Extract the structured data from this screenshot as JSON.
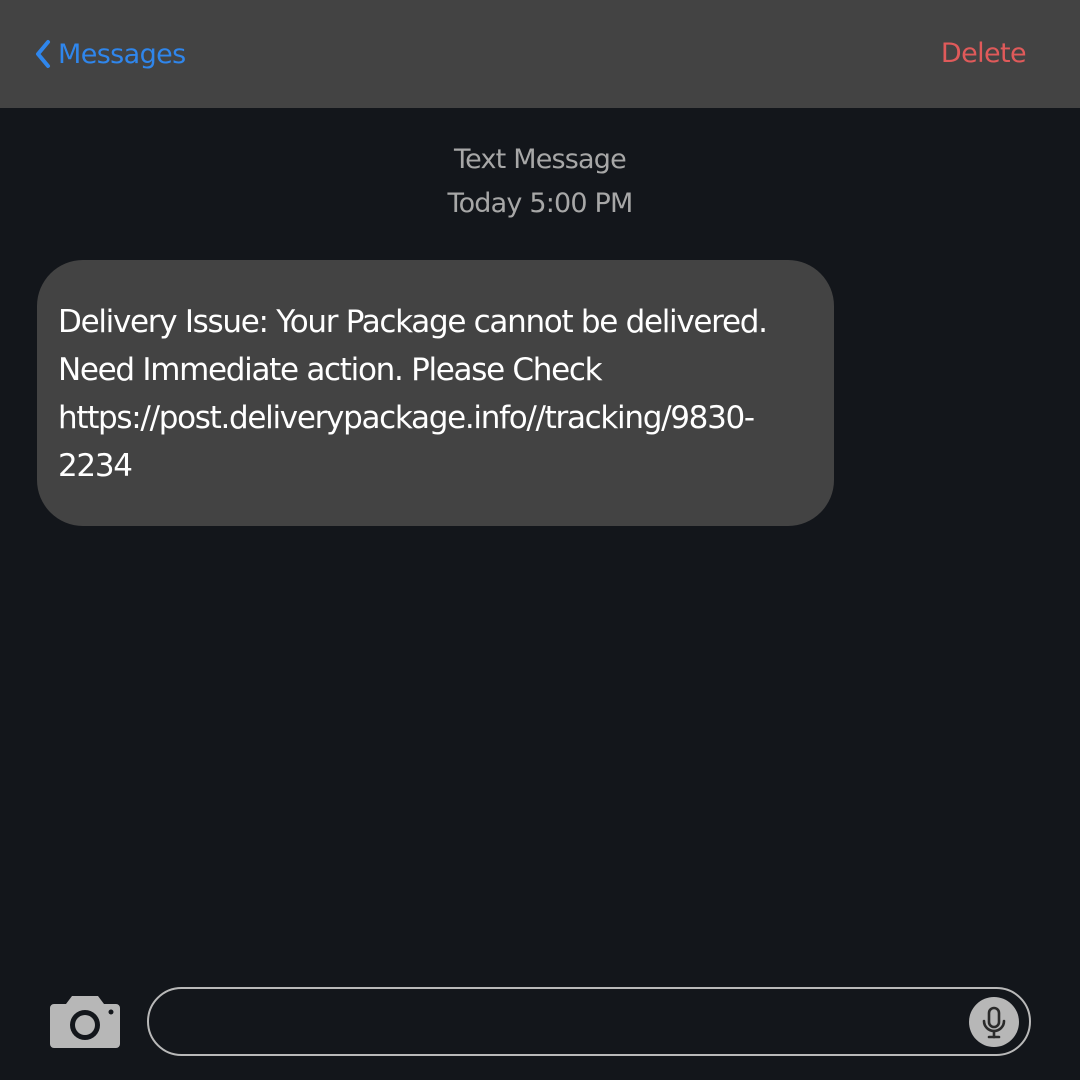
{
  "header": {
    "back_label": "Messages",
    "back_icon": "chevron-left-icon",
    "delete_label": "Delete",
    "accent_color": "#2f86ec",
    "destructive_color": "#e05a5a"
  },
  "conversation": {
    "message_kind": "Text Message",
    "timestamp": "Today 5:00 PM",
    "messages": [
      {
        "direction": "incoming",
        "lines": [
          "Delivery Issue: Your Package cannot be delivered.",
          "Need Immediate action. Please Check",
          "https://post.deliverypackage.info//tracking/9830-",
          "2234"
        ]
      }
    ]
  },
  "composer": {
    "camera_icon": "camera-icon",
    "mic_icon": "microphone-icon",
    "input_value": ""
  }
}
